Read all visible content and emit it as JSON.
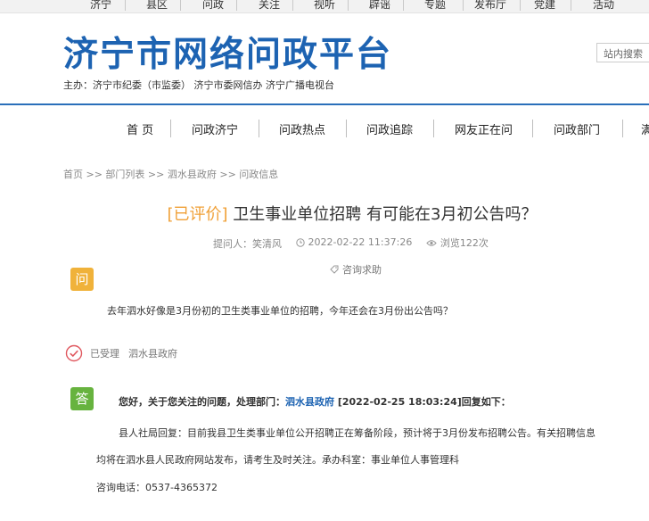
{
  "top_nav": [
    "济宁",
    "县区",
    "问政",
    "关注",
    "视听",
    "辟谣",
    "专题",
    "发布厅",
    "党建",
    "活动"
  ],
  "header": {
    "logo": "济宁市网络问政平台",
    "sponsor": "主办：济宁市纪委（市监委）   济宁市委网信办   济宁广播电视台",
    "search_label": "站内搜索"
  },
  "main_nav": [
    "首 页",
    "问政济宁",
    "问政热点",
    "问政追踪",
    "网友正在问",
    "问政部门",
    "满"
  ],
  "breadcrumb": "首页 >> 部门列表 >> 泗水县政府 >> 问政信息",
  "question": {
    "tag": "[已评价]",
    "title": " 卫生事业单位招聘 有可能在3月初公告吗？",
    "asker": "提问人：笑清风",
    "datetime": "2022-02-22 11:37:26",
    "views": "浏览122次",
    "category": "咨询求助",
    "badge": "问",
    "content": "去年泗水好像是3月份初的卫生类事业单位的招聘，今年还会在3月份出公告吗？"
  },
  "status": {
    "label": "已受理",
    "org": "泗水县政府"
  },
  "answer": {
    "badge": "答",
    "head_prefix": "您好，关于您关注的问题，处理部门：",
    "dept": "泗水县政府",
    "head_suffix": " [2022-02-25 18:03:24]回复如下：",
    "line1": "县人社局回复：目前我县卫生类事业单位公开招聘正在筹备阶段，预计将于3月份发布招聘公告。有关招聘信息",
    "line2": "均将在泗水县人民政府网站发布，请考生及时关注。承办科室：事业单位人事管理科",
    "phone": "咨询电话：0537-4365372"
  }
}
